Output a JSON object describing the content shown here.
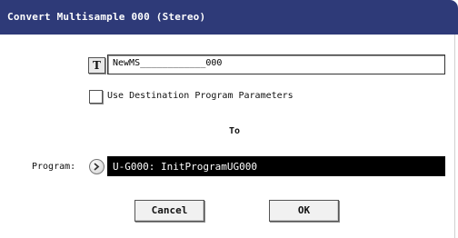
{
  "dialog": {
    "title": "Convert Multisample 000 (Stereo)"
  },
  "name_edit": {
    "text_button_label": "T",
    "value": "NewMS____________000"
  },
  "options": {
    "use_destination_params_label": "Use Destination Program Parameters",
    "use_destination_params_checked": false
  },
  "to_label": "To",
  "program": {
    "label": "Program:",
    "icon": "chevron-circle-right-icon",
    "value": "U-G000: InitProgramUG000"
  },
  "buttons": {
    "cancel": "Cancel",
    "ok": "OK"
  },
  "colors": {
    "titlebar": "#2e3a78",
    "field_selected_bg": "#000000"
  }
}
